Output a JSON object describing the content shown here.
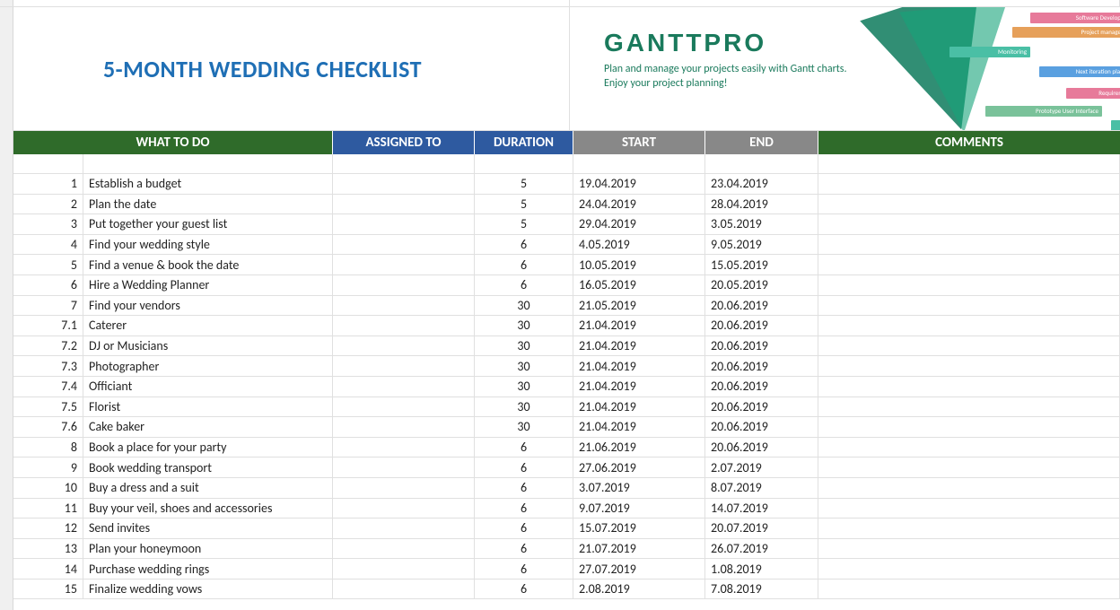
{
  "title": "5-MONTH WEDDING CHECKLIST",
  "brand": {
    "name": "GANTTPRO",
    "tagline1": "Plan and manage your projects easily with Gantt charts.",
    "tagline2": "Enjoy your project planning!",
    "deco_bars": [
      "Software Development",
      "Project management",
      "Monitoring",
      "Next iteration planning",
      "Requirements",
      "Prototype User Interface"
    ]
  },
  "headers": {
    "what": "WHAT TO DO",
    "assigned": "ASSIGNED TO",
    "duration": "DURATION",
    "start": "START",
    "end": "END",
    "comments": "COMMENTS"
  },
  "rows": [
    {
      "n": "1",
      "task": "Establish a budget",
      "assigned": "",
      "duration": "5",
      "start": "19.04.2019",
      "end": "23.04.2019",
      "comments": ""
    },
    {
      "n": "2",
      "task": "Plan the date",
      "assigned": "",
      "duration": "5",
      "start": "24.04.2019",
      "end": "28.04.2019",
      "comments": ""
    },
    {
      "n": "3",
      "task": "Put together your guest list",
      "assigned": "",
      "duration": "5",
      "start": "29.04.2019",
      "end": "3.05.2019",
      "comments": ""
    },
    {
      "n": "4",
      "task": "Find your wedding style",
      "assigned": "",
      "duration": "6",
      "start": "4.05.2019",
      "end": "9.05.2019",
      "comments": ""
    },
    {
      "n": "5",
      "task": "Find a venue & book the date",
      "assigned": "",
      "duration": "6",
      "start": "10.05.2019",
      "end": "15.05.2019",
      "comments": ""
    },
    {
      "n": "6",
      "task": "Hire a Wedding Planner",
      "assigned": "",
      "duration": "6",
      "start": "16.05.2019",
      "end": "20.05.2019",
      "comments": ""
    },
    {
      "n": "7",
      "task": "Find your vendors",
      "assigned": "",
      "duration": "30",
      "start": "21.05.2019",
      "end": "20.06.2019",
      "comments": ""
    },
    {
      "n": "7.1",
      "task": "Caterer",
      "assigned": "",
      "duration": "30",
      "start": "21.04.2019",
      "end": "20.06.2019",
      "comments": ""
    },
    {
      "n": "7.2",
      "task": "DJ or Musicians",
      "assigned": "",
      "duration": "30",
      "start": "21.04.2019",
      "end": "20.06.2019",
      "comments": ""
    },
    {
      "n": "7.3",
      "task": "Photographer",
      "assigned": "",
      "duration": "30",
      "start": "21.04.2019",
      "end": "20.06.2019",
      "comments": ""
    },
    {
      "n": "7.4",
      "task": "Officiant",
      "assigned": "",
      "duration": "30",
      "start": "21.04.2019",
      "end": "20.06.2019",
      "comments": ""
    },
    {
      "n": "7.5",
      "task": "Florist",
      "assigned": "",
      "duration": "30",
      "start": "21.04.2019",
      "end": "20.06.2019",
      "comments": ""
    },
    {
      "n": "7.6",
      "task": "Cake baker",
      "assigned": "",
      "duration": "30",
      "start": "21.04.2019",
      "end": "20.06.2019",
      "comments": ""
    },
    {
      "n": "8",
      "task": "Book a place for your party",
      "assigned": "",
      "duration": "6",
      "start": "21.06.2019",
      "end": "20.06.2019",
      "comments": ""
    },
    {
      "n": "9",
      "task": "Book wedding transport",
      "assigned": "",
      "duration": "6",
      "start": "27.06.2019",
      "end": "2.07.2019",
      "comments": ""
    },
    {
      "n": "10",
      "task": "Buy a dress and a suit",
      "assigned": "",
      "duration": "6",
      "start": "3.07.2019",
      "end": "8.07.2019",
      "comments": ""
    },
    {
      "n": "11",
      "task": "Buy your veil, shoes and accessories",
      "assigned": "",
      "duration": "6",
      "start": "9.07.2019",
      "end": "14.07.2019",
      "comments": ""
    },
    {
      "n": "12",
      "task": "Send invites",
      "assigned": "",
      "duration": "6",
      "start": "15.07.2019",
      "end": "20.07.2019",
      "comments": ""
    },
    {
      "n": "13",
      "task": "Plan your honeymoon",
      "assigned": "",
      "duration": "6",
      "start": "21.07.2019",
      "end": "26.07.2019",
      "comments": ""
    },
    {
      "n": "14",
      "task": "Purchase wedding rings",
      "assigned": "",
      "duration": "6",
      "start": "27.07.2019",
      "end": "1.08.2019",
      "comments": ""
    },
    {
      "n": "15",
      "task": "Finalize wedding vows",
      "assigned": "",
      "duration": "6",
      "start": "2.08.2019",
      "end": "7.08.2019",
      "comments": ""
    }
  ]
}
